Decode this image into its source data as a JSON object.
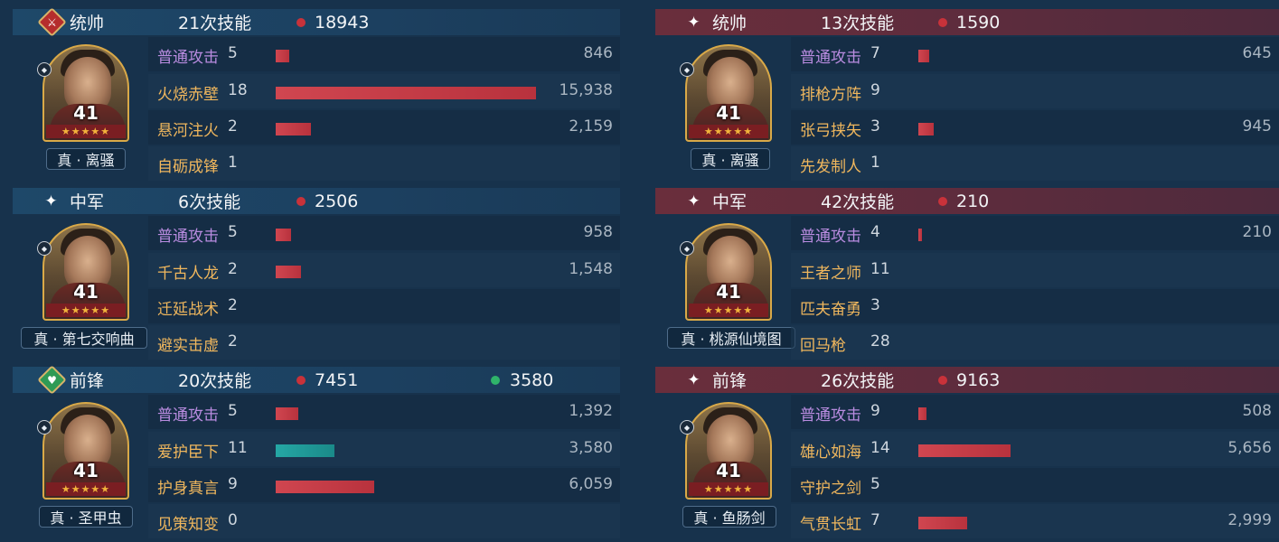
{
  "left": [
    {
      "role": "统帅",
      "role_icon": "red-sword-diamond-icon",
      "skill_count": "21次技能",
      "damage": "18943",
      "heal": null,
      "level": "41",
      "gear": "真 · 离骚",
      "skills": [
        {
          "name": "普通攻击",
          "uses": "5",
          "damage": "846",
          "kind": "normal",
          "bar": 0.053,
          "bar_color": "red"
        },
        {
          "name": "火烧赤壁",
          "uses": "18",
          "damage": "15,938",
          "kind": "special",
          "bar": 1.0,
          "bar_color": "red"
        },
        {
          "name": "悬河注火",
          "uses": "2",
          "damage": "2,159",
          "kind": "special",
          "bar": 0.135,
          "bar_color": "red"
        },
        {
          "name": "自砺成锋",
          "uses": "1",
          "damage": "",
          "kind": "special",
          "bar": 0,
          "bar_color": "red"
        }
      ]
    },
    {
      "role": "中军",
      "role_icon": "sparkle-icon",
      "skill_count": "6次技能",
      "damage": "2506",
      "heal": null,
      "level": "41",
      "gear": "真 · 第七交响曲",
      "skills": [
        {
          "name": "普通攻击",
          "uses": "5",
          "damage": "958",
          "kind": "normal",
          "bar": 0.06,
          "bar_color": "red"
        },
        {
          "name": "千古人龙",
          "uses": "2",
          "damage": "1,548",
          "kind": "special",
          "bar": 0.097,
          "bar_color": "red"
        },
        {
          "name": "迁延战术",
          "uses": "2",
          "damage": "",
          "kind": "special",
          "bar": 0,
          "bar_color": "red"
        },
        {
          "name": "避实击虚",
          "uses": "2",
          "damage": "",
          "kind": "special",
          "bar": 0,
          "bar_color": "red"
        }
      ]
    },
    {
      "role": "前锋",
      "role_icon": "green-heart-diamond-icon",
      "skill_count": "20次技能",
      "damage": "7451",
      "heal": "3580",
      "level": "41",
      "gear": "真 · 圣甲虫",
      "skills": [
        {
          "name": "普通攻击",
          "uses": "5",
          "damage": "1,392",
          "kind": "normal",
          "bar": 0.087,
          "bar_color": "red"
        },
        {
          "name": "爱护臣下",
          "uses": "11",
          "damage": "3,580",
          "kind": "special",
          "bar": 0.225,
          "bar_color": "green"
        },
        {
          "name": "护身真言",
          "uses": "9",
          "damage": "6,059",
          "kind": "special",
          "bar": 0.38,
          "bar_color": "red"
        },
        {
          "name": "见策知变",
          "uses": "0",
          "damage": "",
          "kind": "special",
          "bar": 0,
          "bar_color": "red"
        }
      ]
    }
  ],
  "right": [
    {
      "role": "统帅",
      "role_icon": "sparkle-icon",
      "skill_count": "13次技能",
      "damage": "1590",
      "heal": null,
      "level": "41",
      "gear": "真 · 离骚",
      "skills": [
        {
          "name": "普通攻击",
          "uses": "7",
          "damage": "645",
          "kind": "normal",
          "bar": 0.04,
          "bar_color": "red"
        },
        {
          "name": "排枪方阵",
          "uses": "9",
          "damage": "",
          "kind": "special",
          "bar": 0,
          "bar_color": "red"
        },
        {
          "name": "张弓挟矢",
          "uses": "3",
          "damage": "945",
          "kind": "special",
          "bar": 0.059,
          "bar_color": "red"
        },
        {
          "name": "先发制人",
          "uses": "1",
          "damage": "",
          "kind": "special",
          "bar": 0,
          "bar_color": "red"
        }
      ]
    },
    {
      "role": "中军",
      "role_icon": "sparkle-icon",
      "skill_count": "42次技能",
      "damage": "210",
      "heal": null,
      "level": "41",
      "gear": "真 · 桃源仙境图",
      "skills": [
        {
          "name": "普通攻击",
          "uses": "4",
          "damage": "210",
          "kind": "normal",
          "bar": 0.013,
          "bar_color": "red"
        },
        {
          "name": "王者之师",
          "uses": "11",
          "damage": "",
          "kind": "special",
          "bar": 0,
          "bar_color": "red"
        },
        {
          "name": "匹夫奋勇",
          "uses": "3",
          "damage": "",
          "kind": "special",
          "bar": 0,
          "bar_color": "red"
        },
        {
          "name": "回马枪",
          "uses": "28",
          "damage": "",
          "kind": "special",
          "bar": 0,
          "bar_color": "red"
        }
      ]
    },
    {
      "role": "前锋",
      "role_icon": "sparkle-icon",
      "skill_count": "26次技能",
      "damage": "9163",
      "heal": null,
      "level": "41",
      "gear": "真 · 鱼肠剑",
      "skills": [
        {
          "name": "普通攻击",
          "uses": "9",
          "damage": "508",
          "kind": "normal",
          "bar": 0.032,
          "bar_color": "red"
        },
        {
          "name": "雄心如海",
          "uses": "14",
          "damage": "5,656",
          "kind": "special",
          "bar": 0.355,
          "bar_color": "red"
        },
        {
          "name": "守护之剑",
          "uses": "5",
          "damage": "",
          "kind": "special",
          "bar": 0,
          "bar_color": "red"
        },
        {
          "name": "气贯长虹",
          "uses": "7",
          "damage": "2,999",
          "kind": "special",
          "bar": 0.188,
          "bar_color": "red"
        }
      ]
    }
  ],
  "stars": "★★★★★",
  "colors": {
    "damage": "#c8323a",
    "heal": "#2fb36a",
    "normal_attack": "#b98ce0",
    "tactic": "#f0b75d"
  }
}
